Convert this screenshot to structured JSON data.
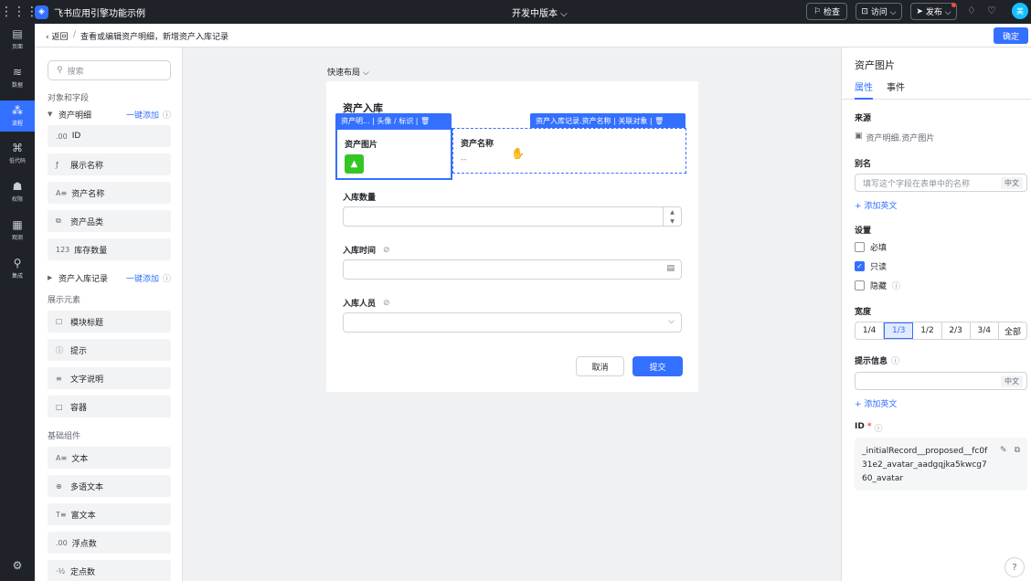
{
  "topbar": {
    "app_name": "飞书应用引擎功能示例",
    "version": "开发中版本 ⌵",
    "inspect": "检查",
    "visit": "访问 ⌵",
    "publish": "发布 ⌵",
    "avatar_text": "美"
  },
  "nav": [
    {
      "label": "页面",
      "icon": "▤"
    },
    {
      "label": "数据",
      "icon": "≋"
    },
    {
      "label": "流程",
      "icon": "⁂"
    },
    {
      "label": "低代码",
      "icon": "⌘"
    },
    {
      "label": "权限",
      "icon": "☗"
    },
    {
      "label": "观测",
      "icon": "▦"
    },
    {
      "label": "集成",
      "icon": "⚲"
    }
  ],
  "crumb": {
    "back": "‹ 返回",
    "sep": "/",
    "text": "查看或编辑资产明细，新增资产入库记录",
    "confirm": "确定"
  },
  "left": {
    "search_placeholder": "搜索",
    "section_fields": "对象和字段",
    "obj1": {
      "name": "资产明细",
      "add": "一键添加"
    },
    "obj1_fields": [
      {
        "icon": ".00",
        "label": "ID"
      },
      {
        "icon": "ƒ",
        "label": "展示名称"
      },
      {
        "icon": "A≡",
        "label": "资产名称"
      },
      {
        "icon": "⧉",
        "label": "资产品类"
      },
      {
        "icon": "123",
        "label": "库存数量"
      }
    ],
    "obj2": {
      "name": "资产入库记录",
      "add": "一键添加"
    },
    "section_display": "展示元素",
    "display_items": [
      {
        "icon": "☐",
        "label": "模块标题"
      },
      {
        "icon": "ⓘ",
        "label": "提示"
      },
      {
        "icon": "≡",
        "label": "文字说明"
      },
      {
        "icon": "□",
        "label": "容器"
      }
    ],
    "section_basic": "基础组件",
    "basic_items": [
      {
        "icon": "A≡",
        "label": "文本"
      },
      {
        "icon": "⊕",
        "label": "多语文本"
      },
      {
        "icon": "T≡",
        "label": "富文本"
      },
      {
        "icon": ".00",
        "label": "浮点数"
      },
      {
        "icon": "·½",
        "label": "定点数"
      }
    ]
  },
  "canvas": {
    "quick_layout": "快速布局 ⌵",
    "form_title": "资产入库",
    "tag_left": "资产明...  | 头像 / 标识 | 🗑",
    "tag_right": "资产入库记录.资产名称 | 关联对象 | 🗑",
    "img_field_label": "资产图片",
    "name_field_label": "资产名称",
    "name_field_value": "--",
    "qty_label": "入库数量",
    "time_label": "入库时间",
    "person_label": "入库人员",
    "cancel": "取消",
    "submit": "提交"
  },
  "right": {
    "title": "资产图片",
    "tab_props": "属性",
    "tab_events": "事件",
    "source_h": "来源",
    "source_val": "资产明细.资产图片",
    "alias_h": "别名",
    "alias_placeholder": "填写这个字段在表单中的名称",
    "lang_suffix": "中文",
    "add_english": "+ 添加英文",
    "settings_h": "设置",
    "required": "必填",
    "readonly": "只读",
    "hidden": "隐藏",
    "width_h": "宽度",
    "widths": [
      "1/4",
      "1/3",
      "1/2",
      "2/3",
      "3/4",
      "全部"
    ],
    "width_selected": "1/3",
    "hint_h": "提示信息",
    "id_h": "ID",
    "id_value": "_initialRecord__proposed__fc0f31e2_avatar_aadgqjka5kwcg760_avatar"
  },
  "colors": {
    "accent": "#3370ff",
    "topbar": "#1f2329",
    "success": "#34c724"
  }
}
